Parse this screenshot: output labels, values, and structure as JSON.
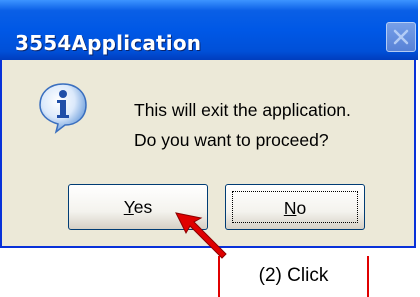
{
  "dialog": {
    "title": "3554Application",
    "message_line1": "This will exit the application.",
    "message_line2": "Do you want to proceed?",
    "icon": "info-icon"
  },
  "buttons": {
    "yes_accel": "Y",
    "yes_rest": "es",
    "no_accel": "N",
    "no_rest": "o"
  },
  "annotation": {
    "callout_text": "(2) Click",
    "color": "#e00000"
  },
  "colors": {
    "titlebar": "#0058e6",
    "dialog_bg": "#ece9d8"
  }
}
